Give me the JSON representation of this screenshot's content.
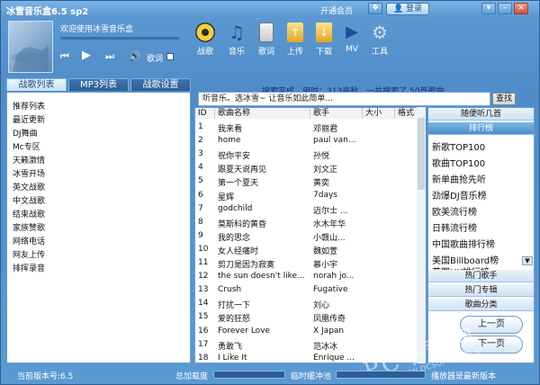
{
  "window": {
    "title": "冰雪音乐盒6.5 sp2",
    "member_link": "开通会员",
    "login_label": "登录"
  },
  "player": {
    "welcome": "欢迎使用冰雪音乐盒",
    "lyrics_label": "歌词"
  },
  "toolbar": {
    "items": [
      {
        "label": "战歌"
      },
      {
        "label": "音乐"
      },
      {
        "label": "歌词"
      },
      {
        "label": "上传"
      },
      {
        "label": "下载"
      },
      {
        "label": "MV"
      },
      {
        "label": "工具"
      }
    ]
  },
  "tabs": [
    {
      "label": "战歌列表"
    },
    {
      "label": "MP3列表"
    },
    {
      "label": "战歌设置"
    }
  ],
  "left_list": [
    "推荐列表",
    "最近更新",
    "DJ舞曲",
    "Mc专区",
    "天籁激情",
    "冰雪开场",
    "英文战歌",
    "中文战歌",
    "结束战歌",
    "家族赞歌",
    "网络电话",
    "网友上传",
    "排挥录音"
  ],
  "status_line": "搜索完成，用时：313毫秒，一共搜索了 50首歌曲",
  "search": {
    "value": "听音乐。选冰雪~ 让音乐如此简单...",
    "button": "查找"
  },
  "table": {
    "headers": [
      "ID",
      "歌曲名称",
      "歌手",
      "大小",
      "格式"
    ],
    "rows": [
      [
        "1",
        "我来看",
        "邓丽君"
      ],
      [
        "2",
        "home",
        "paul van..."
      ],
      [
        "3",
        "祝你平安",
        "孙悦"
      ],
      [
        "4",
        "跟夏天说再见",
        "刘文正"
      ],
      [
        "5",
        "第一个夏天",
        "黄奕"
      ],
      [
        "6",
        "星辉",
        "7days"
      ],
      [
        "7",
        "godchild",
        "迈尔士 ..."
      ],
      [
        "8",
        "莫斯科的黄昏",
        "水木年华"
      ],
      [
        "9",
        "我的思念",
        "小赣山..."
      ],
      [
        "10",
        "女人经痛时",
        "魏如萱"
      ],
      [
        "11",
        "剪刀是因为寂寞",
        "慕小宇"
      ],
      [
        "12",
        "the sun doesn't like...",
        "norah jo..."
      ],
      [
        "13",
        "Crush",
        "Fugative"
      ],
      [
        "14",
        "打扰一下",
        "刘心"
      ],
      [
        "15",
        "爱的狂怒",
        "凤凰传奇"
      ],
      [
        "16",
        "Forever Love",
        "X Japan"
      ],
      [
        "17",
        "勇敢飞",
        "范冰冰"
      ],
      [
        "18",
        "I Like It",
        "Enrique ..."
      ]
    ]
  },
  "side": {
    "random_label": "随便听几首",
    "charts_header": "排行榜",
    "charts": [
      "新歌TOP100",
      "歌曲TOP100",
      "新单曲抢先听",
      "劲爆DJ音乐榜",
      "欧美流行榜",
      "日韩流行榜",
      "中国歌曲排行榜",
      "美国Billboard榜",
      "英国UK排行榜"
    ],
    "hot_singers": "热门歌手",
    "hot_albums": "热门专辑",
    "categories": "歌曲分类",
    "prev_page": "上一页",
    "next_page": "下一页"
  },
  "footer": {
    "version": "当前版本号:6.5",
    "total_load": "总加载度",
    "buffer": "临时缓冲池",
    "latest": "播放器是最新版本"
  },
  "watermark": {
    "big": "PC下载网",
    "small": "www.pcsoft.com.cn"
  },
  "colors": {
    "window_blue": "#5b98d1",
    "title_bar": "#7bb3e6",
    "panel_border": "#6a9ccd",
    "charts_header": "#4d8cc8"
  }
}
